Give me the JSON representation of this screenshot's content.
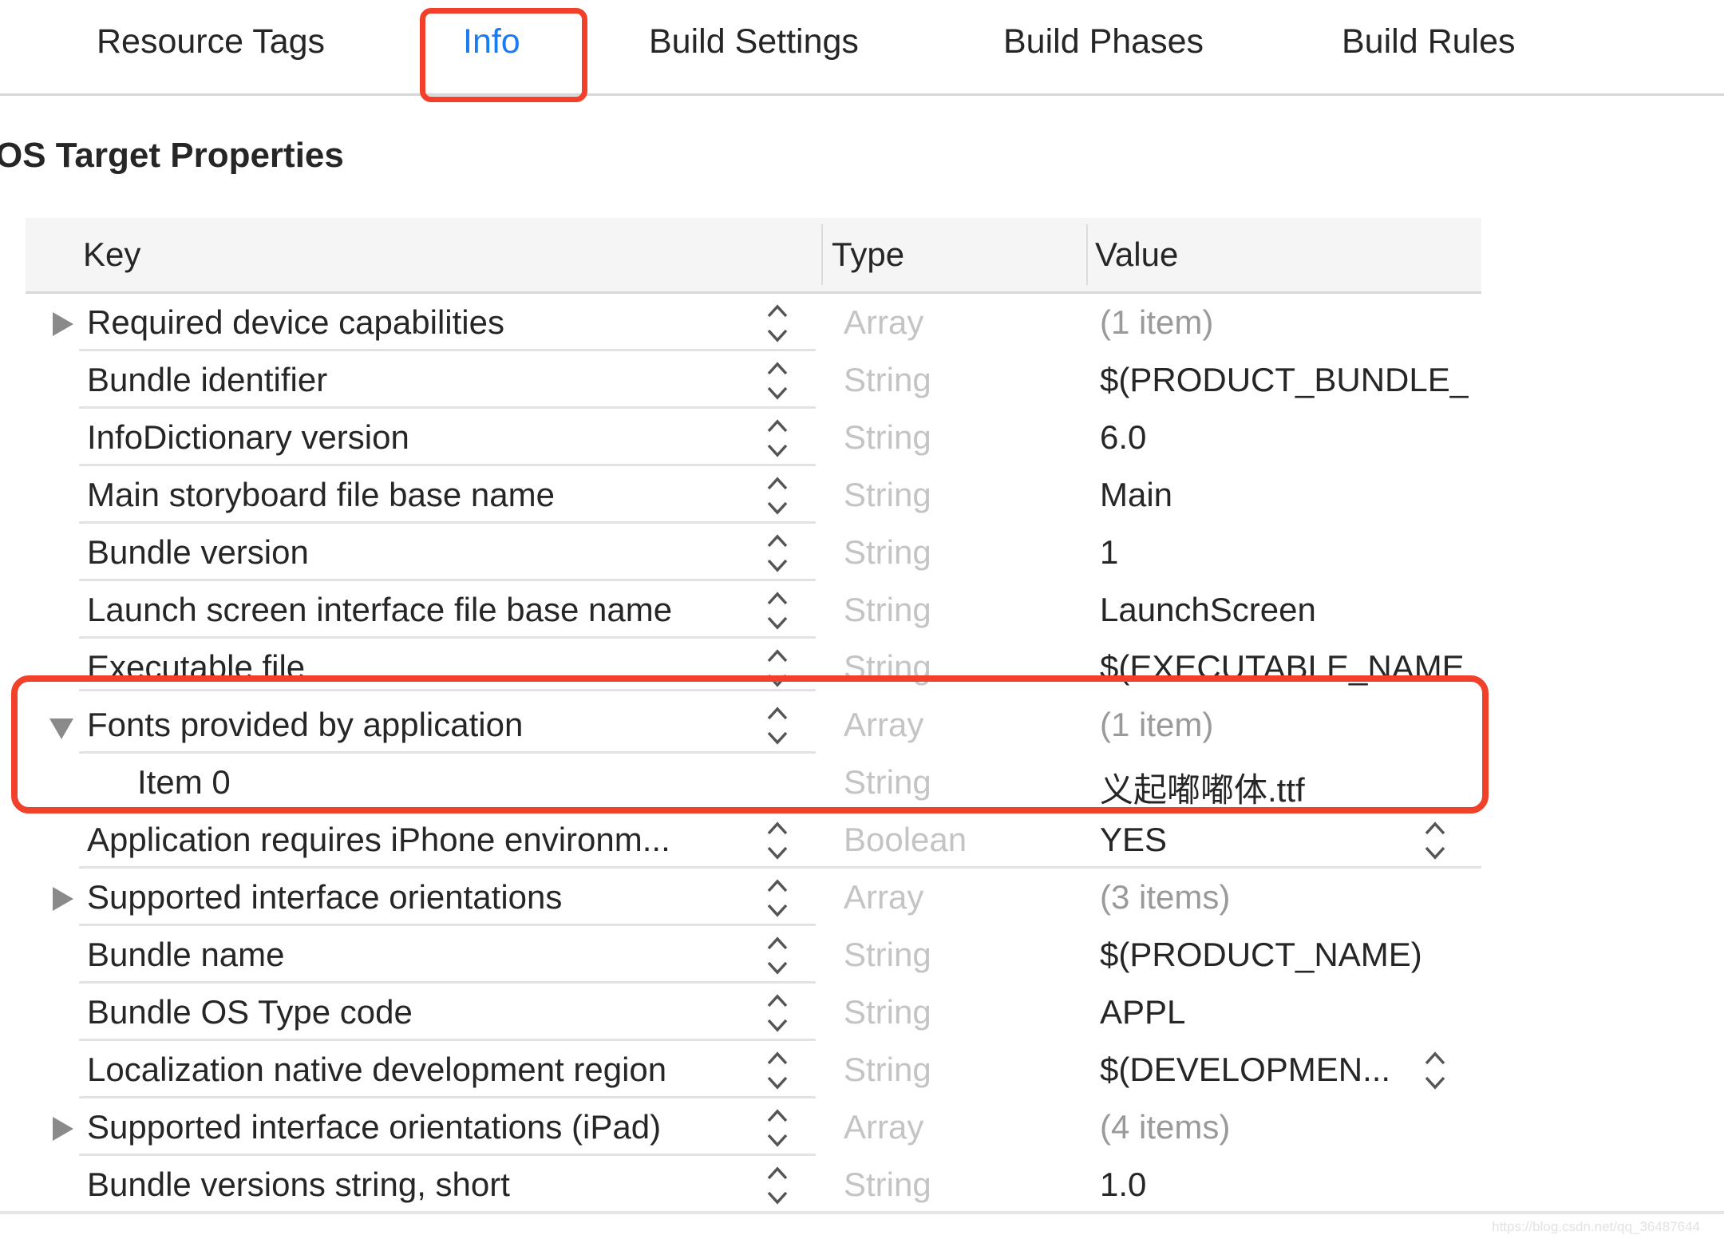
{
  "tabs": [
    {
      "label": "Resource Tags",
      "active": false
    },
    {
      "label": "Info",
      "active": true
    },
    {
      "label": "Build Settings",
      "active": false
    },
    {
      "label": "Build Phases",
      "active": false
    },
    {
      "label": "Build Rules",
      "active": false
    }
  ],
  "section_title": "OS Target Properties",
  "table": {
    "headers": {
      "key": "Key",
      "type": "Type",
      "value": "Value"
    },
    "rows": [
      {
        "key": "Required device capabilities",
        "type": "Array",
        "value": "(1 item)",
        "disclosure": "collapsed",
        "level": 0,
        "value_stepper": false
      },
      {
        "key": "Bundle identifier",
        "type": "String",
        "value": "$(PRODUCT_BUNDLE_",
        "disclosure": "none",
        "level": 0,
        "value_stepper": false
      },
      {
        "key": "InfoDictionary version",
        "type": "String",
        "value": "6.0",
        "disclosure": "none",
        "level": 0,
        "value_stepper": false
      },
      {
        "key": "Main storyboard file base name",
        "type": "String",
        "value": "Main",
        "disclosure": "none",
        "level": 0,
        "value_stepper": false
      },
      {
        "key": "Bundle version",
        "type": "String",
        "value": "1",
        "disclosure": "none",
        "level": 0,
        "value_stepper": false
      },
      {
        "key": "Launch screen interface file base name",
        "type": "String",
        "value": "LaunchScreen",
        "disclosure": "none",
        "level": 0,
        "value_stepper": false
      },
      {
        "key": "Executable file",
        "type": "String",
        "value": "$(EXECUTABLE_NAME",
        "disclosure": "none",
        "level": 0,
        "value_stepper": false
      },
      {
        "key": "Fonts provided by application",
        "type": "Array",
        "value": "(1 item)",
        "disclosure": "expanded",
        "level": 0,
        "value_stepper": false
      },
      {
        "key": "Item 0",
        "type": "String",
        "value": "义起嘟嘟体.ttf",
        "disclosure": "none",
        "level": 1,
        "value_stepper": false
      },
      {
        "key": "Application requires iPhone environm...",
        "type": "Boolean",
        "value": "YES",
        "disclosure": "none",
        "level": 0,
        "value_stepper": true
      },
      {
        "key": "Supported interface orientations",
        "type": "Array",
        "value": "(3 items)",
        "disclosure": "collapsed",
        "level": 0,
        "value_stepper": false
      },
      {
        "key": "Bundle name",
        "type": "String",
        "value": "$(PRODUCT_NAME)",
        "disclosure": "none",
        "level": 0,
        "value_stepper": false
      },
      {
        "key": "Bundle OS Type code",
        "type": "String",
        "value": "APPL",
        "disclosure": "none",
        "level": 0,
        "value_stepper": false
      },
      {
        "key": "Localization native development region",
        "type": "String",
        "value": "$(DEVELOPMEN...",
        "disclosure": "none",
        "level": 0,
        "value_stepper": true
      },
      {
        "key": "Supported interface orientations (iPad)",
        "type": "Array",
        "value": "(4 items)",
        "disclosure": "collapsed",
        "level": 0,
        "value_stepper": false
      },
      {
        "key": "Bundle versions string, short",
        "type": "String",
        "value": "1.0",
        "disclosure": "none",
        "level": 0,
        "value_stepper": false
      }
    ]
  },
  "highlight_color": "#f2412a",
  "accent_color": "#1a7cf5",
  "watermark": "https://blog.csdn.net/qq_36487644"
}
